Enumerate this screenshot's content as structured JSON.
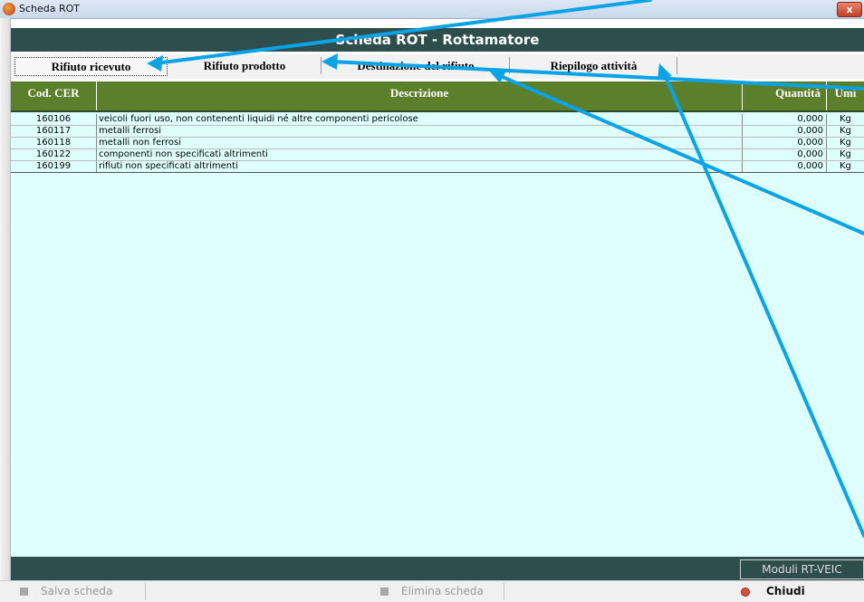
{
  "window": {
    "title": "Scheda ROT",
    "close_label": "x"
  },
  "header": {
    "title": "Scheda ROT - Rottamatore"
  },
  "tabs": [
    {
      "label": "Rifiuto ricevuto"
    },
    {
      "label": "Rifiuto prodotto"
    },
    {
      "label": "Destinazione del rifiuto"
    },
    {
      "label": "Riepilogo attività"
    }
  ],
  "table": {
    "columns": [
      "Cod. CER",
      "Descrizione",
      "Quantità",
      "Umi"
    ],
    "rows": [
      {
        "code": "160106",
        "desc": "veicoli fuori uso, non contenenti liquidi né altre componenti pericolose",
        "qty": "0,000",
        "unit": "Kg"
      },
      {
        "code": "160117",
        "desc": "metalli ferrosi",
        "qty": "0,000",
        "unit": "Kg"
      },
      {
        "code": "160118",
        "desc": "metalli non ferrosi",
        "qty": "0,000",
        "unit": "Kg"
      },
      {
        "code": "160122",
        "desc": "componenti non specificati altrimenti",
        "qty": "0,000",
        "unit": "Kg"
      },
      {
        "code": "160199",
        "desc": "rifiuti non specificati altrimenti",
        "qty": "0,000",
        "unit": "Kg"
      }
    ]
  },
  "footer": {
    "moduli_label": "Moduli RT-VEIC"
  },
  "bottombar": {
    "save_label": "Salva scheda",
    "delete_label": "Elimina scheda",
    "close_label": "Chiudi"
  },
  "colors": {
    "header_bg": "#2e4d4d",
    "grid_header_bg": "#5b7f2b",
    "grid_bg": "#dfffff",
    "annotation_arrow": "#0aa3e6"
  }
}
